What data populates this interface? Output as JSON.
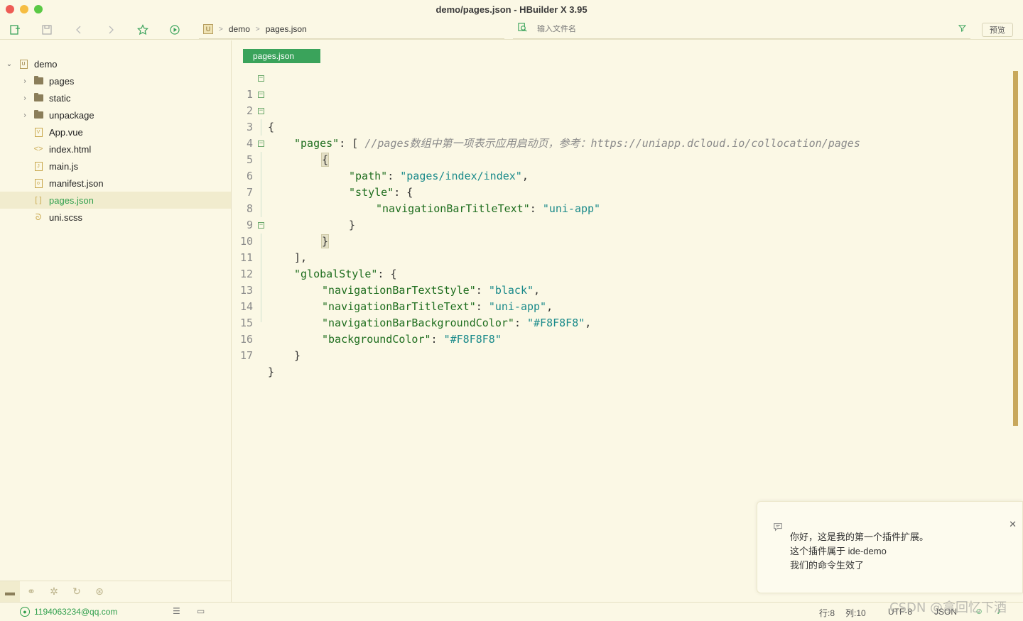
{
  "window": {
    "title": "demo/pages.json - HBuilder X 3.95",
    "lights": [
      "#ee5c55",
      "#f6bd41",
      "#5ac945"
    ]
  },
  "toolbar": {
    "breadcrumb": [
      "demo",
      "pages.json"
    ],
    "search_placeholder": "输入文件名",
    "preview_label": "预览"
  },
  "sidebar": {
    "items": [
      {
        "label": "demo",
        "type": "project",
        "expanded": true
      },
      {
        "label": "pages",
        "type": "folder"
      },
      {
        "label": "static",
        "type": "folder"
      },
      {
        "label": "unpackage",
        "type": "folder"
      },
      {
        "label": "App.vue",
        "type": "vue"
      },
      {
        "label": "index.html",
        "type": "html"
      },
      {
        "label": "main.js",
        "type": "js"
      },
      {
        "label": "manifest.json",
        "type": "manifest"
      },
      {
        "label": "pages.json",
        "type": "json",
        "active": true
      },
      {
        "label": "uni.scss",
        "type": "scss"
      }
    ]
  },
  "editor": {
    "tab_label": "pages.json",
    "line_numbers": [
      "1",
      "2",
      "3",
      "4",
      "5",
      "6",
      "7",
      "8",
      "9",
      "10",
      "11",
      "12",
      "13",
      "14",
      "15",
      "16",
      "17"
    ],
    "comment": "//pages数组中第一项表示应用启动页，参考：https://uniapp.dcloud.io/collocation/pages",
    "keys": {
      "pages": "\"pages\"",
      "path": "\"path\"",
      "style": "\"style\"",
      "navTitle": "\"navigationBarTitleText\"",
      "globalStyle": "\"globalStyle\"",
      "navTextStyle": "\"navigationBarTextStyle\"",
      "navBg": "\"navigationBarBackgroundColor\"",
      "bg": "\"backgroundColor\""
    },
    "values": {
      "path": "\"pages/index/index\"",
      "navTitle": "\"uni-app\"",
      "navTextStyle": "\"black\"",
      "navTitle2": "\"uni-app\"",
      "navBg": "\"#F8F8F8\"",
      "bg": "\"#F8F8F8\""
    }
  },
  "notification": {
    "lines": [
      "你好，这是我的第一个插件扩展。",
      "这个插件属于 ide-demo",
      "我们的命令生效了"
    ]
  },
  "status": {
    "user": "1194063234@qq.com",
    "row": "行:8",
    "col": "列:10",
    "encoding": "UTF-8",
    "language": "JSON"
  },
  "watermark": "CSDN @拿回忆下酒",
  "colors": {
    "accent": "#3aa35b",
    "background": "#fbf8e5",
    "json_key": "#1f6e1f",
    "json_string": "#1a8a8a"
  }
}
